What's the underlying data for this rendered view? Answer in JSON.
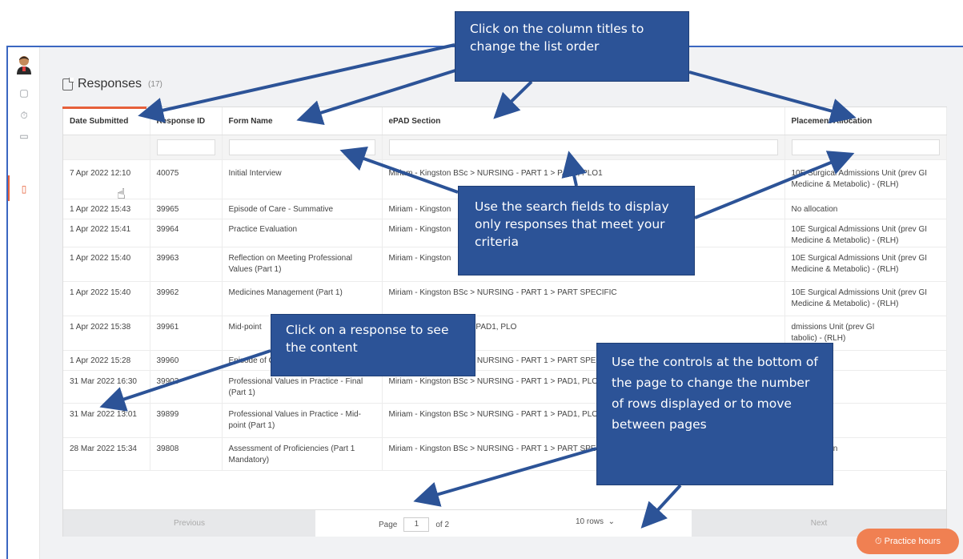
{
  "page": {
    "title": "Responses",
    "count": "(17)"
  },
  "table": {
    "headers": [
      "Date Submitted",
      "Response ID",
      "Form Name",
      "ePAD Section",
      "Placement Allocation"
    ],
    "rows": [
      {
        "date": "7 Apr 2022 12:10",
        "id": "40075",
        "form": "Initial Interview",
        "section": "Miriam - Kingston BSc > NURSING - PART 1 > PAD1, PLO1",
        "placement": "10E Surgical Admissions Unit (prev GI Medicine & Metabolic) - (RLH)"
      },
      {
        "date": "1 Apr 2022 15:43",
        "id": "39965",
        "form": "Episode of Care - Summative",
        "section": "Miriam - Kingston",
        "placement": "No allocation"
      },
      {
        "date": "1 Apr 2022 15:41",
        "id": "39964",
        "form": "Practice Evaluation",
        "section": "Miriam - Kingston",
        "placement": "10E Surgical Admissions Unit (prev GI Medicine & Metabolic) - (RLH)"
      },
      {
        "date": "1 Apr 2022 15:40",
        "id": "39963",
        "form": "Reflection on Meeting Professional Values (Part 1)",
        "section": "Miriam - Kingston",
        "placement": "10E Surgical Admissions Unit (prev GI Medicine & Metabolic) - (RLH)"
      },
      {
        "date": "1 Apr 2022 15:40",
        "id": "39962",
        "form": "Medicines Management (Part 1)",
        "section": "Miriam - Kingston BSc > NURSING - PART 1 > PART SPECIFIC",
        "placement": "10E Surgical Admissions Unit (prev GI Medicine & Metabolic) - (RLH)"
      },
      {
        "date": "1 Apr 2022 15:38",
        "id": "39961",
        "form": "Mid-point",
        "section": "> NURSING - PART 1 > PAD1, PLO",
        "placement": "dmissions Unit (prev GI\ntabolic) - (RLH)"
      },
      {
        "date": "1 Apr 2022 15:28",
        "id": "39960",
        "form": "Episode of Care - Formative",
        "section": "Miriam - Kingston BSc > NURSING - PART 1 > PART SPEC",
        "placement": ""
      },
      {
        "date": "31 Mar 2022 16:30",
        "id": "39903",
        "form": "Professional Values in Practice - Final (Part 1)",
        "section": "Miriam - Kingston BSc > NURSING - PART 1 > PAD1, PLO",
        "placement": ""
      },
      {
        "date": "31 Mar 2022 13:01",
        "id": "39899",
        "form": "Professional Values in Practice - Mid-point (Part 1)",
        "section": "Miriam - Kingston BSc > NURSING - PART 1 > PAD1, PLO",
        "placement": ""
      },
      {
        "date": "28 Mar 2022 15:34",
        "id": "39808",
        "form": "Assessment of Proficiencies (Part 1 Mandatory)",
        "section": "Miriam - Kingston BSc > NURSING - PART 1 > PART SPECIFIC",
        "placement": "No allocation"
      }
    ]
  },
  "pager": {
    "previous": "Previous",
    "page_label": "Page",
    "page_value": "1",
    "of_label": "of 2",
    "rows_value": "10 rows",
    "next": "Next"
  },
  "practice_button": "Practice hours",
  "callouts": {
    "c1": "Click on the column titles to change the list order",
    "c2": "Use the search fields to display only responses that meet your criteria",
    "c3": "Click on a response to see the content",
    "c4": "Use the controls at the bottom of the page to change the number of rows displayed or to move between pages"
  },
  "colors": {
    "accent": "#e6603a",
    "callout_bg": "#2c5397",
    "frame": "#3b67c1",
    "practice": "#f08052"
  }
}
